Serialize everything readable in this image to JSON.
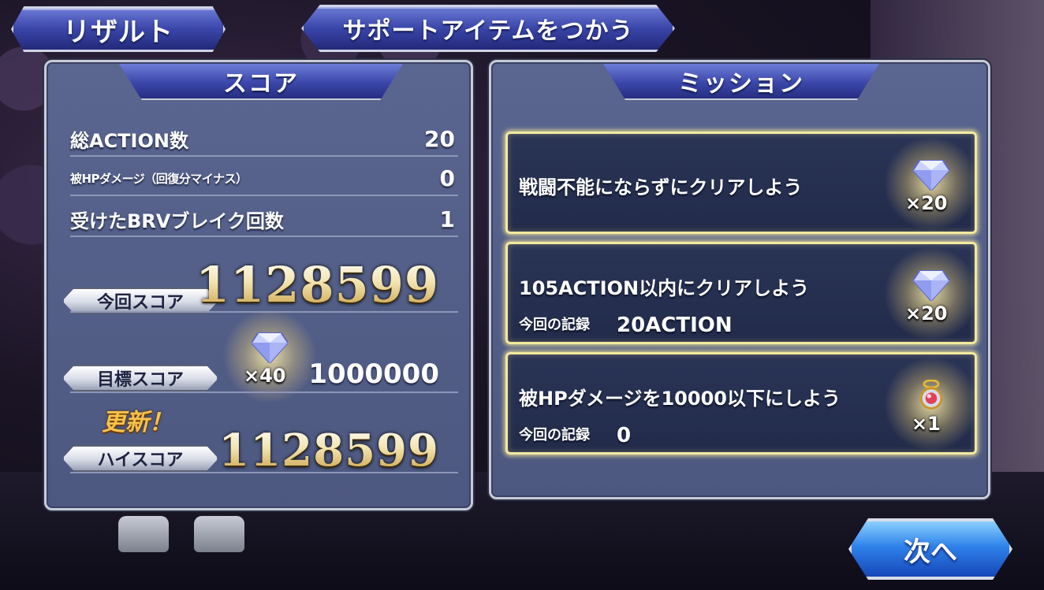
{
  "tabs": {
    "result": "リザルト",
    "support_items": "サポートアイテムをつかう"
  },
  "score_panel": {
    "header": "スコア",
    "stats": [
      {
        "label": "総ACTION数",
        "value": "20"
      },
      {
        "label": "被HPダメージ（回復分マイナス）",
        "value": "0"
      },
      {
        "label": "受けたBRVブレイク回数",
        "value": "1"
      }
    ],
    "current_score": {
      "label": "今回スコア",
      "value": "1128599"
    },
    "target_score": {
      "label": "目標スコア",
      "value": "1000000",
      "reward_qty": "×40",
      "reward_icon": "diamond-gem-icon"
    },
    "updated_label": "更新！",
    "high_score": {
      "label": "ハイスコア",
      "value": "1128599"
    }
  },
  "mission_panel": {
    "header": "ミッション",
    "missions": [
      {
        "title": "戦闘不能にならずにクリアしよう",
        "record_label": "",
        "record_value": "",
        "reward_qty": "×20",
        "reward_icon": "diamond-gem-icon"
      },
      {
        "title": "105ACTION以内にクリアしよう",
        "record_label": "今回の記録",
        "record_value": "20ACTION",
        "reward_qty": "×20",
        "reward_icon": "diamond-gem-icon"
      },
      {
        "title": "被HPダメージを10000以下にしよう",
        "record_label": "今回の記録",
        "record_value": "0",
        "reward_qty": "×1",
        "reward_icon": "crystal-amulet-icon"
      }
    ]
  },
  "next_button": "次へ",
  "colors": {
    "panel_bg": "#5a6690",
    "tab_blue": "#3a45a8",
    "mission_glow": "#f1e9a0",
    "score_gold": "#f3e4b0",
    "update_orange": "#f6c24a"
  }
}
